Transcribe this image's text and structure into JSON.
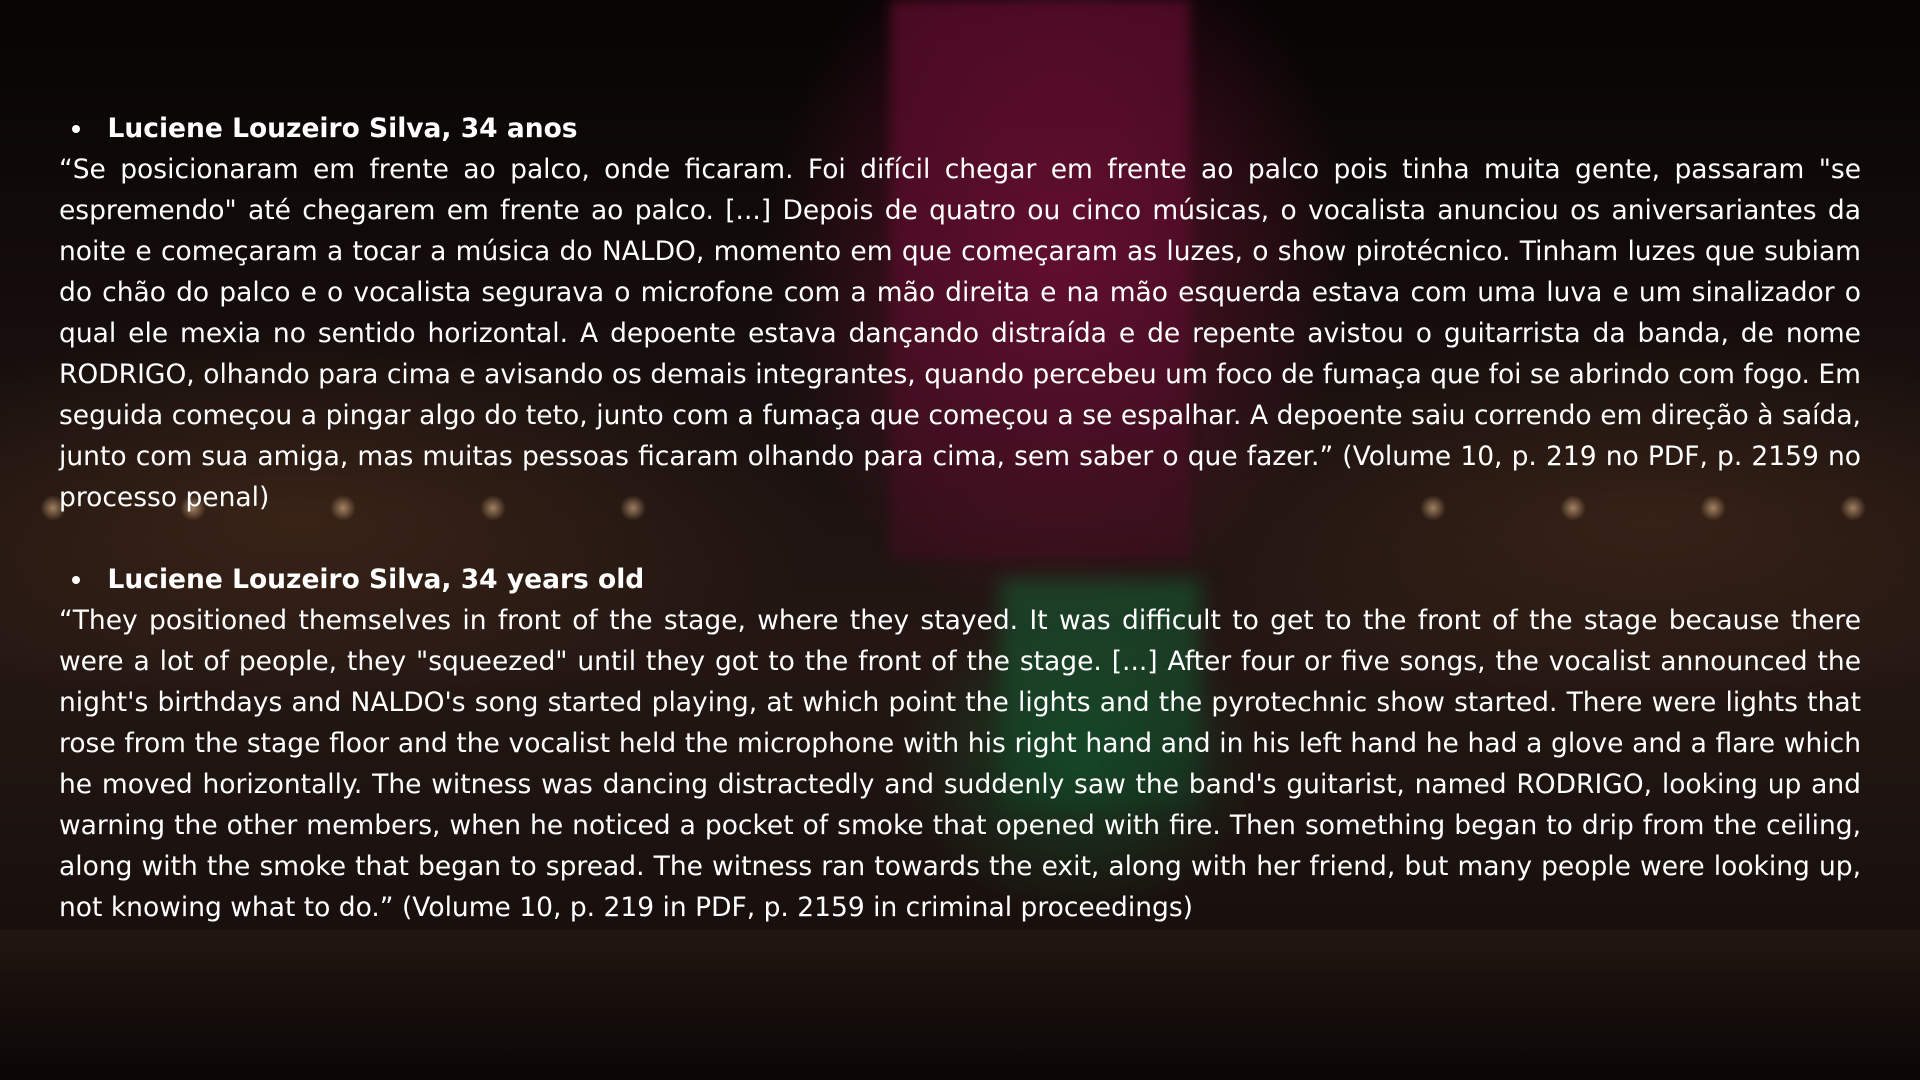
{
  "entries": [
    {
      "title": "Luciene Louzeiro Silva, 34 anos",
      "quote": " “Se posicionaram em frente ao palco, onde ficaram. Foi difícil chegar em frente ao palco pois tinha muita gente, passaram \"se espremendo\" até chegarem em frente ao palco. [...] Depois de quatro ou cinco músicas, o vocalista anunciou os aniversariantes da noite e começaram a tocar a música do NALDO, momento em que começaram as luzes, o show pirotécnico. Tinham luzes que subiam do chão do palco e o vocalista segurava o microfone com a mão direita e na mão esquerda estava com uma luva e um sinalizador o qual ele mexia no sentido horizontal. A depoente estava dançando distraída e de repente avistou o guitarrista da banda, de nome RODRIGO, olhando para cima e avisando os demais integrantes, quando percebeu um foco de fumaça que foi se abrindo com fogo. Em seguida começou a pingar algo do teto, junto com a fumaça que começou a se espalhar. A depoente saiu correndo em direção à saída, junto com sua amiga, mas muitas pessoas ficaram olhando para cima, sem saber o que fazer.” (Volume 10, p. 219 no PDF, p. 2159 no processo penal)"
    },
    {
      "title": "Luciene Louzeiro Silva, 34 years old",
      "quote": "“They positioned themselves in front of the stage, where they stayed. It was difficult to get to the front of the stage because there were a lot of people, they \"squeezed\" until they got to the front of the stage. [...] After four or five songs, the vocalist announced the night's birthdays and NALDO's song started playing, at which point the lights and the pyrotechnic show started. There were lights that rose from the stage floor and the vocalist held the microphone with his right hand and in his left hand he had a glove and a flare which he moved horizontally. The witness was dancing distractedly and suddenly saw the band's guitarist, named RODRIGO, looking up and warning the other members, when he noticed a pocket of smoke that opened with fire. Then something began to drip from the ceiling, along with the smoke that began to spread. The witness ran towards the exit, along with her friend, but many people were looking up, not knowing what to do.” (Volume 10, p. 219 in PDF, p. 2159 in criminal proceedings)"
    }
  ]
}
